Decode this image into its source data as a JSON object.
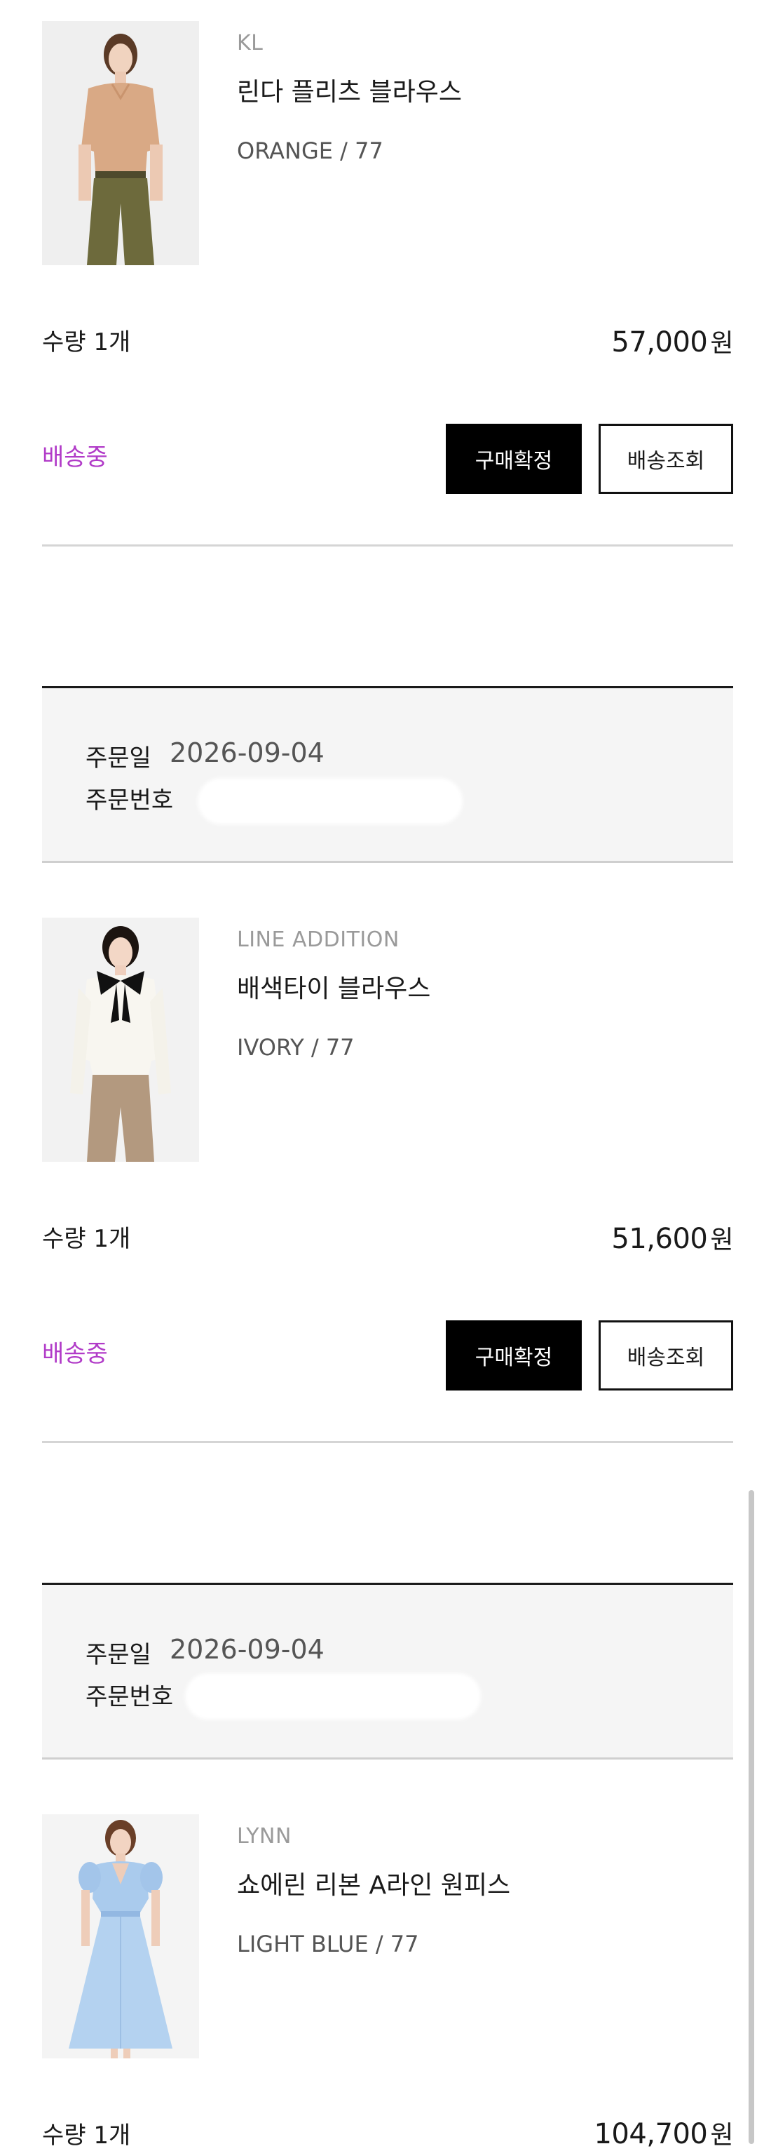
{
  "orders": [
    {
      "product": {
        "brand": "KL",
        "name": "린다 플리츠 블라우스",
        "option": "ORANGE / 77",
        "quantity": "수량 1개",
        "price": "57,000",
        "currency": "원",
        "status": "배송중"
      },
      "actions": {
        "confirm": "구매확정",
        "track": "배송조회"
      }
    },
    {
      "header": {
        "date_label": "주문일",
        "date": "2026-09-04",
        "number_label": "주문번호"
      },
      "product": {
        "brand": "LINE ADDITION",
        "name": "배색타이 블라우스",
        "option": "IVORY / 77",
        "quantity": "수량 1개",
        "price": "51,600",
        "currency": "원",
        "status": "배송중"
      },
      "actions": {
        "confirm": "구매확정",
        "track": "배송조회"
      }
    },
    {
      "header": {
        "date_label": "주문일",
        "date": "2026-09-04",
        "number_label": "주문번호"
      },
      "product": {
        "brand": "LYNN",
        "name": "쇼에린 리본 A라인 원피스",
        "option": "LIGHT BLUE / 77",
        "quantity": "수량 1개",
        "price": "104,700",
        "currency": "원"
      }
    }
  ],
  "colors": {
    "status": "#b13bc8",
    "confirm_button_bg": "#000000",
    "order_header_bg": "#f5f5f5"
  }
}
